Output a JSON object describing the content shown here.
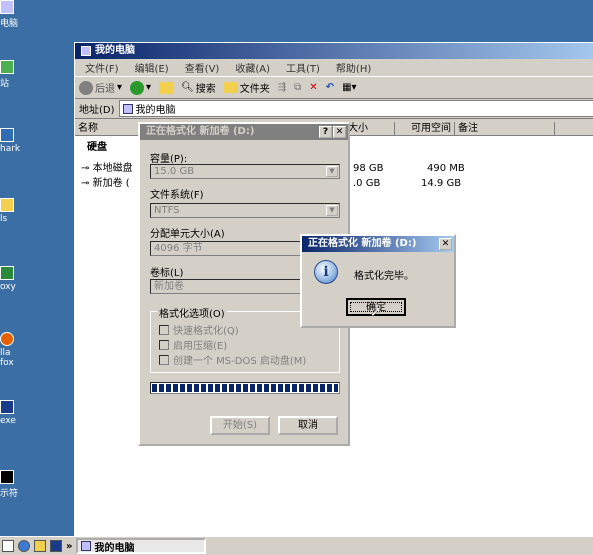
{
  "desktop": {
    "icons": [
      {
        "label": "电脑",
        "icon": "computer-icon"
      },
      {
        "label": "站",
        "icon": "network-icon"
      },
      {
        "label": "hark",
        "icon": "app-icon"
      },
      {
        "label": "ls",
        "icon": "folder-icon"
      },
      {
        "label": "oxy",
        "icon": "proxy-icon"
      },
      {
        "label": "lla",
        "label2": "fox",
        "icon": "firefox-icon"
      },
      {
        "label": "exe",
        "icon": "exe-icon"
      },
      {
        "label": "示符",
        "icon": "cmd-icon"
      }
    ]
  },
  "explorer": {
    "title": "我的电脑",
    "menu": [
      "文件(F)",
      "编辑(E)",
      "查看(V)",
      "收藏(A)",
      "工具(T)",
      "帮助(H)"
    ],
    "toolbar": {
      "back": "后退",
      "search": "搜索",
      "folders": "文件夹"
    },
    "address_label": "地址(D)",
    "address_value": "我的电脑",
    "columns": [
      "名称",
      "总大小",
      "可用空间",
      "备注"
    ],
    "group": "硬盘",
    "rows": [
      {
        "name": "本地磁盘",
        "total": "98 GB",
        "free": "490 MB"
      },
      {
        "name": "新加卷 (",
        "total": ".0 GB",
        "free": "14.9 GB"
      }
    ]
  },
  "format_dialog": {
    "title": "正在格式化 新加卷 (D:)",
    "capacity_label": "容量(P):",
    "capacity_value": "15.0 GB",
    "fs_label": "文件系统(F)",
    "fs_value": "NTFS",
    "alloc_label": "分配单元大小(A)",
    "alloc_value": "4096 字节",
    "volume_label": "卷标(L)",
    "volume_value": "新加卷",
    "options_title": "格式化选项(O)",
    "options": [
      "快速格式化(Q)",
      "启用压缩(E)",
      "创建一个 MS-DOS 启动盘(M)"
    ],
    "progress": 1.0,
    "start_button": "开始(S)",
    "cancel_button": "取消"
  },
  "message_box": {
    "title": "正在格式化 新加卷 (D:)",
    "message": "格式化完毕。",
    "ok_button": "确定"
  },
  "taskbar": {
    "task_label": "我的电脑"
  }
}
